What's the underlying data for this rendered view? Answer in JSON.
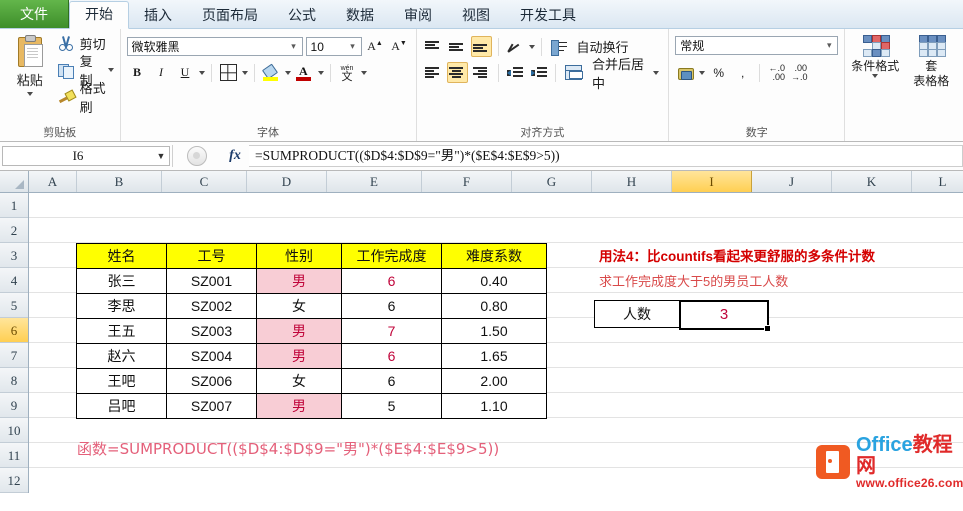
{
  "window": {
    "tabs": [
      {
        "label": "文件",
        "kind": "file"
      },
      {
        "label": "开始",
        "kind": "active"
      },
      {
        "label": "插入",
        "kind": "normal"
      },
      {
        "label": "页面布局",
        "kind": "normal"
      },
      {
        "label": "公式",
        "kind": "normal"
      },
      {
        "label": "数据",
        "kind": "normal"
      },
      {
        "label": "审阅",
        "kind": "normal"
      },
      {
        "label": "视图",
        "kind": "normal"
      },
      {
        "label": "开发工具",
        "kind": "normal"
      }
    ]
  },
  "ribbon": {
    "clipboard": {
      "group_label": "剪贴板",
      "paste_label": "粘贴",
      "cut_label": "剪切",
      "copy_label": "复制",
      "format_painter_label": "格式刷"
    },
    "font": {
      "group_label": "字体",
      "font_name": "微软雅黑",
      "font_size": "10",
      "grow_label": "A",
      "shrink_label": "A",
      "bold_label": "B",
      "italic_label": "I",
      "underline_label": "U",
      "phonetic_top": "wén",
      "phonetic_bottom": "文"
    },
    "alignment": {
      "group_label": "对齐方式",
      "wrap_text_label": "自动换行",
      "merge_center_label": "合并后居中"
    },
    "number": {
      "group_label": "数字",
      "format_value": "常规",
      "percent_label": "%",
      "comma_label": ",",
      "inc_dec_label": ".00",
      "dec_dec_label": ".00"
    },
    "styles": {
      "conditional_label": "条件格式",
      "table_label_line1": "套",
      "table_label_line2": "表格格"
    }
  },
  "formula_bar": {
    "name_box": "I6",
    "formula": "=SUMPRODUCT(($D$4:$D$9=\"男\")*($E$4:$E$9>5))"
  },
  "grid": {
    "columns": [
      "A",
      "B",
      "C",
      "D",
      "E",
      "F",
      "G",
      "H",
      "I",
      "J",
      "K",
      "L"
    ],
    "selected_column": "I",
    "rows": [
      "1",
      "2",
      "3",
      "4",
      "5",
      "6",
      "7",
      "8",
      "9",
      "10",
      "11",
      "12"
    ],
    "selected_row": "6"
  },
  "table": {
    "headers": [
      "姓名",
      "工号",
      "性别",
      "工作完成度",
      "难度系数"
    ],
    "rows": [
      {
        "name": "张三",
        "id": "SZ001",
        "gender": "男",
        "score": "6",
        "coef": "0.40"
      },
      {
        "name": "李思",
        "id": "SZ002",
        "gender": "女",
        "score": "6",
        "coef": "0.80"
      },
      {
        "name": "王五",
        "id": "SZ003",
        "gender": "男",
        "score": "7",
        "coef": "1.50"
      },
      {
        "name": "赵六",
        "id": "SZ004",
        "gender": "男",
        "score": "6",
        "coef": "1.65"
      },
      {
        "name": "王吧",
        "id": "SZ006",
        "gender": "女",
        "score": "6",
        "coef": "2.00"
      },
      {
        "name": "吕吧",
        "id": "SZ007",
        "gender": "男",
        "score": "5",
        "coef": "1.10"
      }
    ]
  },
  "annotations": {
    "title": "用法4：比countifs看起来更舒服的多条件计数",
    "subtitle": "求工作完成度大于5的男员工人数",
    "result_label": "人数",
    "result_value": "3",
    "bottom_formula": "函数=SUMPRODUCT(($D$4:$D$9=\"男\")*($E$4:$E$9>5))"
  },
  "watermark": {
    "brand_en": "Office",
    "brand_cn": "教程网",
    "url": "www.office26.com"
  }
}
